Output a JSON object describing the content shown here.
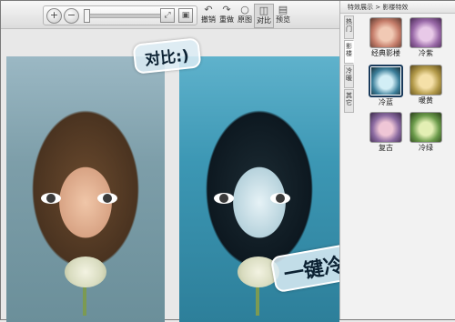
{
  "toolbar": {
    "zoom_in_icon": "zoom-in",
    "zoom_out_icon": "zoom-out",
    "zoom_slider_level": 0.0,
    "buttons": [
      {
        "label": "撤销",
        "icon": "undo-icon"
      },
      {
        "label": "重做",
        "icon": "redo-icon"
      },
      {
        "label": "原图",
        "icon": "original-icon"
      },
      {
        "label": "对比",
        "icon": "compare-icon"
      },
      {
        "label": "预览",
        "icon": "preview-icon"
      }
    ]
  },
  "canvas": {
    "annotation_top": "对比:)",
    "annotation_bottom": "一键冷蓝效果"
  },
  "panel": {
    "breadcrumb": "特效展示 > 影楼特效",
    "tabs": [
      "热门",
      "影楼",
      "冷暖",
      "其它"
    ],
    "effects": [
      {
        "label": "经典影楼",
        "tint": "#c57d6a"
      },
      {
        "label": "冷紫",
        "tint": "#9a6aa8"
      },
      {
        "label": "冷蓝",
        "tint": "#3d7f9a"
      },
      {
        "label": "暖黄",
        "tint": "#b39a4a"
      },
      {
        "label": "复古",
        "tint": "#8a6aa0"
      },
      {
        "label": "冷绿",
        "tint": "#6a9a4a"
      }
    ]
  }
}
